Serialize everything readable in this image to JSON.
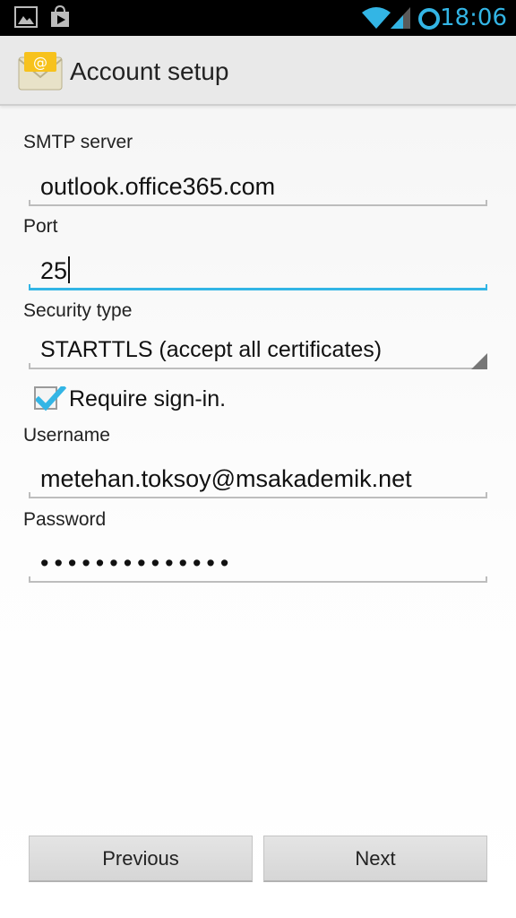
{
  "status_bar": {
    "time": "18:06",
    "icons": [
      "gallery-icon",
      "play-store-icon",
      "wifi-icon",
      "signal-icon",
      "sync-ring-icon"
    ],
    "accent_color": "#33b5e5"
  },
  "action_bar": {
    "title": "Account setup",
    "icon": "email-envelope-icon"
  },
  "form": {
    "smtp_server": {
      "label": "SMTP server",
      "value": "outlook.office365.com"
    },
    "port": {
      "label": "Port",
      "value": "25",
      "focused": true
    },
    "security_type": {
      "label": "Security type",
      "value": "STARTTLS (accept all certificates)"
    },
    "require_signin": {
      "label": "Require sign-in.",
      "checked": true
    },
    "username": {
      "label": "Username",
      "value": "metehan.toksoy@msakademik.net"
    },
    "password": {
      "label": "Password",
      "value": "••••••••••••••"
    }
  },
  "buttons": {
    "previous": "Previous",
    "next": "Next"
  }
}
